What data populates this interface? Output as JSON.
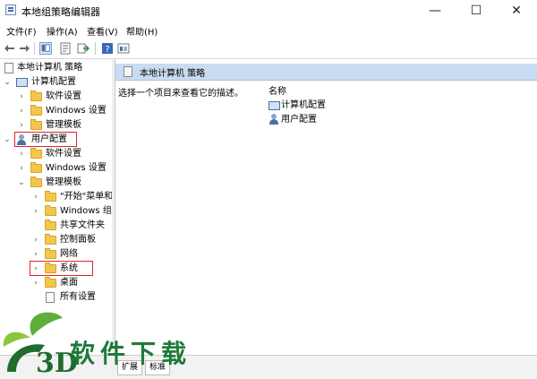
{
  "window": {
    "title": "本地组策略编辑器",
    "controls": {
      "minimize": "—",
      "maximize": "☐",
      "close": "✕"
    }
  },
  "menubar": {
    "items": [
      "文件(F)",
      "操作(A)",
      "查看(V)",
      "帮助(H)"
    ]
  },
  "toolbar": {
    "icons": [
      "back-arrow-icon",
      "forward-arrow-icon",
      "show-hide-tree-icon",
      "properties-icon",
      "export-list-icon",
      "help-icon",
      "view-icon"
    ]
  },
  "tree": {
    "root": "本地计算机 策略",
    "computer_config": "计算机配置",
    "cc_software": "软件设置",
    "cc_windows": "Windows 设置",
    "cc_admin": "管理模板",
    "user_config": "用户配置",
    "uc_software": "软件设置",
    "uc_windows": "Windows 设置",
    "uc_admin": "管理模板",
    "uc_start": "\"开始\"菜单和",
    "uc_wincomp": "Windows 组",
    "uc_shared": "共享文件夹",
    "uc_control": "控制面板",
    "uc_network": "网络",
    "uc_system": "系统",
    "uc_desktop": "桌面",
    "uc_all": "所有设置"
  },
  "right_pane": {
    "header": "本地计算机 策略",
    "description": "选择一个项目来查看它的描述。",
    "column_name": "名称",
    "items": [
      "计算机配置",
      "用户配置"
    ]
  },
  "status_tabs": [
    "扩展",
    "标准"
  ],
  "watermark": {
    "text": "3D软件下载"
  },
  "colors": {
    "highlight_box": "#e0262b",
    "header_bg": "#c9dcf1",
    "watermark": "#1f7a3a"
  }
}
